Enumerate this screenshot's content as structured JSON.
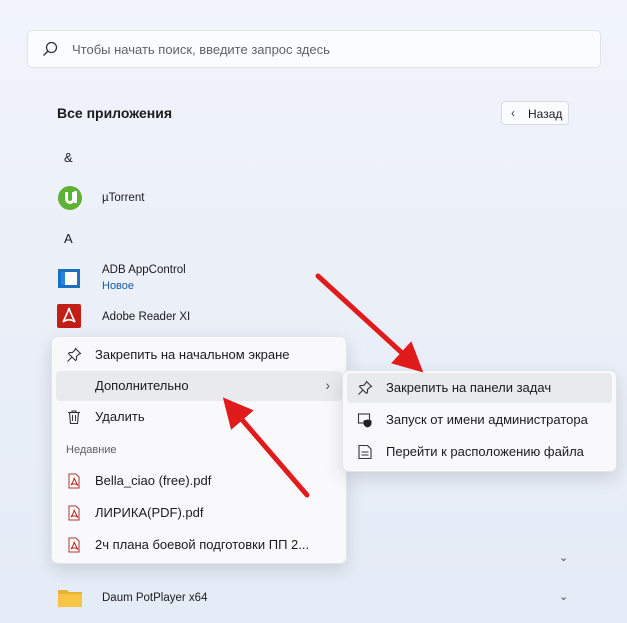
{
  "search": {
    "placeholder": "Чтобы начать поиск, введите запрос здесь"
  },
  "all_apps": {
    "title": "Все приложения",
    "back_label": "Назад"
  },
  "groups": [
    {
      "letter": "&"
    },
    {
      "letter": "A"
    }
  ],
  "apps": [
    {
      "name": "µTorrent",
      "icon": "utorrent-icon"
    },
    {
      "name": "ADB AppControl",
      "badge": "Новое",
      "icon": "adb-appcontrol-icon"
    },
    {
      "name": "Adobe Reader XI",
      "icon": "adobe-reader-icon"
    },
    {
      "name": "Daum PotPlayer x64",
      "icon": "folder-icon"
    }
  ],
  "context_menu": {
    "items": [
      {
        "label": "Закрепить на начальном экране",
        "icon": "pin-icon"
      },
      {
        "label": "Дополнительно",
        "icon": "chevron-right-icon"
      },
      {
        "label": "Удалить",
        "icon": "trash-icon"
      }
    ],
    "recent_label": "Недавние",
    "recent": [
      {
        "label": "Bella_ciao (free).pdf",
        "icon": "pdf-icon"
      },
      {
        "label": "ЛИРИКА(PDF).pdf",
        "icon": "pdf-icon"
      },
      {
        "label": "2ч плана боевой подготовки ПП 2...",
        "icon": "pdf-icon"
      }
    ]
  },
  "submenu": {
    "items": [
      {
        "label": "Закрепить на панели задач",
        "icon": "pin-icon"
      },
      {
        "label": "Запуск от имени администратора",
        "icon": "shield-admin-icon"
      },
      {
        "label": "Перейти к расположению файла",
        "icon": "folder-location-icon"
      }
    ]
  },
  "colors": {
    "arrow": "#e01b1b",
    "link": "#1a5aa8",
    "utorrent": "#5fb236",
    "adobe": "#c31d17",
    "folder": "#f6c544"
  }
}
